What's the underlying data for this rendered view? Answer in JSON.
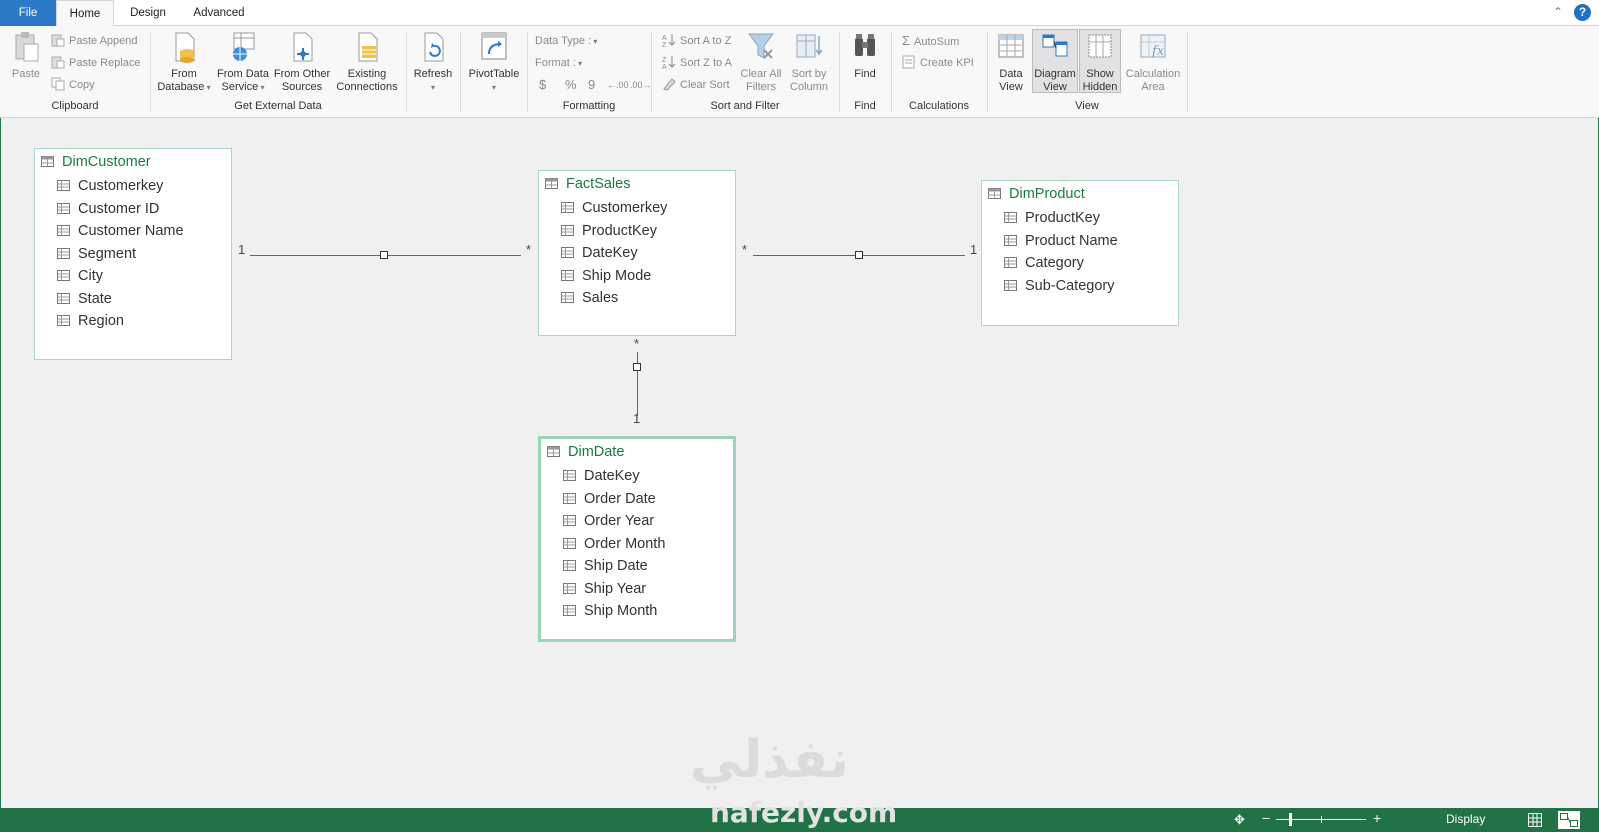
{
  "tabs": {
    "file": "File",
    "home": "Home",
    "design": "Design",
    "advanced": "Advanced"
  },
  "ribbon": {
    "clipboard": {
      "paste": "Paste",
      "paste_append": "Paste Append",
      "paste_replace": "Paste Replace",
      "copy": "Copy",
      "label": "Clipboard"
    },
    "get_external": {
      "from_database": [
        "From",
        "Database"
      ],
      "from_data_service": [
        "From Data",
        "Service"
      ],
      "from_other_sources": [
        "From Other",
        "Sources"
      ],
      "existing_connections": [
        "Existing",
        "Connections"
      ],
      "label": "Get External Data"
    },
    "refresh": "Refresh",
    "pivottable": "PivotTable",
    "formatting": {
      "data_type": "Data Type :",
      "format": "Format :",
      "currency": "$",
      "percent": "%",
      "comma": "9",
      "inc_dec": ".00",
      "dec_dec": ".00",
      "label": "Formatting"
    },
    "sort_filter": {
      "sort_az": "Sort A to Z",
      "sort_za": "Sort Z to A",
      "clear_sort": "Clear Sort",
      "clear_filters": [
        "Clear All",
        "Filters"
      ],
      "sort_by_column": [
        "Sort by",
        "Column"
      ],
      "label": "Sort and Filter"
    },
    "find": {
      "find": "Find",
      "label": "Find"
    },
    "calculations": {
      "autosum": "AutoSum",
      "create_kpi": "Create KPI",
      "label": "Calculations"
    },
    "view": {
      "data_view": [
        "Data",
        "View"
      ],
      "diagram_view": [
        "Diagram",
        "View"
      ],
      "show_hidden": [
        "Show",
        "Hidden"
      ],
      "calculation_area": [
        "Calculation",
        "Area"
      ],
      "label": "View"
    }
  },
  "diagram": {
    "tables": [
      {
        "name": "DimCustomer",
        "columns": [
          "Customerkey",
          "Customer ID",
          "Customer Name",
          "Segment",
          "City",
          "State",
          "Region"
        ]
      },
      {
        "name": "FactSales",
        "columns": [
          "Customerkey",
          "ProductKey",
          "DateKey",
          "Ship Mode",
          "Sales"
        ]
      },
      {
        "name": "DimProduct",
        "columns": [
          "ProductKey",
          "Product Name",
          "Category",
          "Sub-Category"
        ]
      },
      {
        "name": "DimDate",
        "columns": [
          "DateKey",
          "Order Date",
          "Order Year",
          "Order Month",
          "Ship Date",
          "Ship Year",
          "Ship Month"
        ]
      }
    ],
    "relationships": [
      {
        "from": "DimCustomer",
        "to": "FactSales",
        "one": "1",
        "many": "*"
      },
      {
        "from": "DimProduct",
        "to": "FactSales",
        "one": "1",
        "many": "*"
      },
      {
        "from": "DimDate",
        "to": "FactSales",
        "one": "1",
        "many": "*"
      }
    ]
  },
  "watermark": {
    "arabic": "نفذلي",
    "latin": "nafezly.com"
  },
  "status": {
    "display": "Display"
  }
}
